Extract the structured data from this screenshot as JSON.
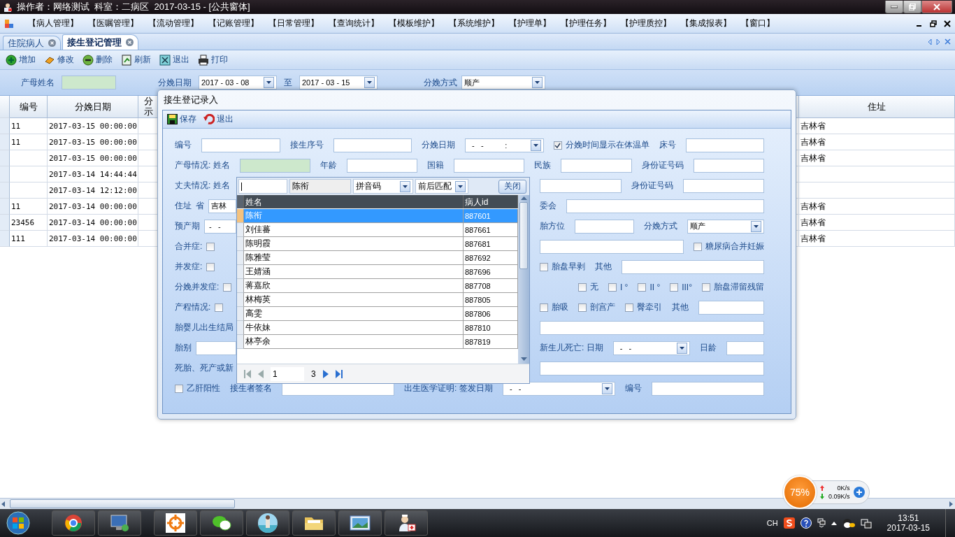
{
  "window": {
    "title": "操作者：网络测试  科室：二病区  2017-03-15 - [公共窗体]"
  },
  "menu": [
    "【病人管理】",
    "【医嘱管理】",
    "【流动管理】",
    "【记账管理】",
    "【日常管理】",
    "【查询统计】",
    "【模板维护】",
    "【系统维护】",
    "【护理单】",
    "【护理任务】",
    "【护理质控】",
    "【集成报表】",
    "【窗口】"
  ],
  "tabs": [
    {
      "label": "住院病人",
      "selected": false
    },
    {
      "label": "接生登记管理",
      "selected": true
    }
  ],
  "toolbar": [
    "增加",
    "修改",
    "删除",
    "刷新",
    "退出",
    "打印"
  ],
  "filter": {
    "mother_label": "产母姓名",
    "date_label": "分娩日期",
    "date_from": "2017 - 03 - 08",
    "to_label": "至",
    "date_to": "2017 - 03 - 15",
    "method_label": "分娩方式",
    "method": "顺产"
  },
  "table": {
    "columns": [
      "编号",
      "分娩日期",
      "分示",
      "住址"
    ],
    "rows": [
      {
        "number": "11",
        "date": "2017-03-15 00:00:00",
        "address": "吉林省"
      },
      {
        "number": "11",
        "date": "2017-03-15 00:00:00",
        "address": "吉林省"
      },
      {
        "date": "2017-03-15 00:00:00",
        "address": "吉林省"
      },
      {
        "date": "2017-03-14 14:44:44"
      },
      {
        "date": "2017-03-14 12:12:00"
      },
      {
        "number": "11",
        "date": "2017-03-14 00:00:00",
        "address": "吉林省"
      },
      {
        "number": "23456",
        "date": "2017-03-14 00:00:00",
        "address": "吉林省"
      },
      {
        "number": "111",
        "date": "2017-03-14 00:00:00",
        "address": "吉林省"
      }
    ]
  },
  "dialog": {
    "title": "接生登记录入",
    "toolbar": [
      "保存",
      "退出"
    ],
    "rows": [
      {
        "items": [
          {
            "kind": "label",
            "text": "编号"
          },
          {
            "kind": "input"
          },
          {
            "kind": "label",
            "text": "接生序号"
          },
          {
            "kind": "input"
          },
          {
            "kind": "label",
            "text": "分娩日期"
          },
          {
            "kind": "select",
            "value": "  -   -          :"
          },
          {
            "kind": "check",
            "text": "分娩时间显示在体温单",
            "checked": true
          },
          {
            "kind": "label",
            "text": "床号"
          },
          {
            "kind": "input"
          }
        ]
      },
      {
        "items": [
          {
            "kind": "label",
            "text": "产母情况: 姓名"
          },
          {
            "kind": "input",
            "required": true
          },
          {
            "kind": "label",
            "text": "年龄"
          },
          {
            "kind": "input"
          },
          {
            "kind": "label",
            "text": "国籍"
          },
          {
            "kind": "input"
          },
          {
            "kind": "label",
            "text": "民族"
          },
          {
            "kind": "input"
          },
          {
            "kind": "label",
            "text": "身份证号码"
          },
          {
            "kind": "input"
          }
        ]
      },
      {
        "left": [
          {
            "kind": "label",
            "text": "丈夫情况: 姓名"
          }
        ],
        "right": [
          {
            "kind": "input"
          },
          {
            "kind": "label",
            "text": "身份证号码"
          },
          {
            "kind": "input"
          }
        ]
      },
      {
        "left": [
          {
            "kind": "label",
            "text": "住址"
          },
          {
            "kind": "label",
            "text": "省"
          },
          {
            "kind": "input",
            "value": "吉林"
          }
        ],
        "right": [
          {
            "kind": "label",
            "text": "委会"
          },
          {
            "kind": "input"
          }
        ]
      },
      {
        "left": [
          {
            "kind": "label",
            "text": "预产期"
          },
          {
            "kind": "input",
            "value": " -   -"
          }
        ],
        "right": [
          {
            "kind": "label",
            "text": "胎方位"
          },
          {
            "kind": "input"
          },
          {
            "kind": "label",
            "text": "分娩方式"
          },
          {
            "kind": "select",
            "value": "顺产"
          }
        ]
      },
      {
        "left": [
          {
            "kind": "label",
            "text": "合并症:"
          },
          {
            "kind": "check",
            "checked": false
          }
        ],
        "right": [
          {
            "kind": "input"
          },
          {
            "kind": "check",
            "text": "糖尿病合并妊娠",
            "checked": false
          }
        ]
      },
      {
        "left": [
          {
            "kind": "label",
            "text": "并发症:"
          },
          {
            "kind": "check",
            "checked": false
          }
        ],
        "right": [
          {
            "kind": "check",
            "text": "胎盘早剥",
            "checked": false
          },
          {
            "kind": "label",
            "text": "其他"
          },
          {
            "kind": "input"
          }
        ]
      },
      {
        "left": [
          {
            "kind": "label",
            "text": "分娩并发症:"
          },
          {
            "kind": "check",
            "checked": false
          }
        ],
        "right": [
          {
            "kind": "check",
            "text": "无",
            "checked": false
          },
          {
            "kind": "check",
            "text": "I °",
            "checked": false
          },
          {
            "kind": "check",
            "text": "II °",
            "checked": false
          },
          {
            "kind": "check",
            "text": "III°",
            "checked": false
          },
          {
            "kind": "check",
            "text": "胎盘滞留残留",
            "checked": false
          }
        ]
      },
      {
        "left": [
          {
            "kind": "label",
            "text": "产程情况:"
          },
          {
            "kind": "check",
            "checked": false
          }
        ],
        "right": [
          {
            "kind": "check",
            "text": "胎吸",
            "checked": false
          },
          {
            "kind": "check",
            "text": "剖宫产",
            "checked": false
          },
          {
            "kind": "check",
            "text": "臀牵引",
            "checked": false
          },
          {
            "kind": "label",
            "text": "其他"
          },
          {
            "kind": "input"
          }
        ]
      },
      {
        "left": [
          {
            "kind": "label",
            "text": "胎婴儿出生结局"
          }
        ],
        "right": [
          {
            "kind": "input"
          }
        ]
      },
      {
        "left": [
          {
            "kind": "label",
            "text": "胎别"
          },
          {
            "kind": "input"
          }
        ],
        "right": [
          {
            "kind": "label",
            "text": "新生儿死亡: 日期"
          },
          {
            "kind": "select",
            "value": "  -   -"
          },
          {
            "kind": "label",
            "text": "日龄"
          },
          {
            "kind": "input"
          }
        ]
      },
      {
        "left": [
          {
            "kind": "label",
            "text": "死胎、死产或新"
          }
        ],
        "right": [
          {
            "kind": "input"
          }
        ]
      },
      {
        "items": [
          {
            "kind": "check",
            "text": "乙肝阳性",
            "checked": false
          },
          {
            "kind": "label",
            "text": "接生者签名"
          },
          {
            "kind": "input"
          },
          {
            "kind": "label",
            "text": "出生医学证明: 签发日期"
          },
          {
            "kind": "select",
            "value": "  -   -"
          },
          {
            "kind": "label",
            "text": "编号"
          },
          {
            "kind": "input"
          }
        ]
      }
    ],
    "lookup": {
      "search_value": "陈衔",
      "mode": "拼音码",
      "match": "前后匹配",
      "close": "关闭",
      "columns": [
        "姓名",
        "病人id"
      ],
      "rows": [
        {
          "name": "陈衔",
          "id": "887601",
          "selected": true
        },
        {
          "name": "刘佳蕃",
          "id": "887661",
          "selected": false
        },
        {
          "name": "陈明霞",
          "id": "887681",
          "selected": false
        },
        {
          "name": "陈雅莹",
          "id": "887692",
          "selected": false
        },
        {
          "name": "王婧涵",
          "id": "887696",
          "selected": false
        },
        {
          "name": "蒋嘉欣",
          "id": "887708",
          "selected": false
        },
        {
          "name": "林梅英",
          "id": "887805",
          "selected": false
        },
        {
          "name": "高雯",
          "id": "887806",
          "selected": false
        },
        {
          "name": "牛依妹",
          "id": "887810",
          "selected": false
        },
        {
          "name": "林亭余",
          "id": "887819",
          "selected": false
        }
      ],
      "page": "1",
      "pages": "3"
    }
  },
  "net_widget": {
    "percent": "75%",
    "up": "0K/s",
    "down": "0.09K/s"
  },
  "taskbar": {
    "lang": "CH",
    "time": "13:51",
    "date": "2017-03-15"
  }
}
